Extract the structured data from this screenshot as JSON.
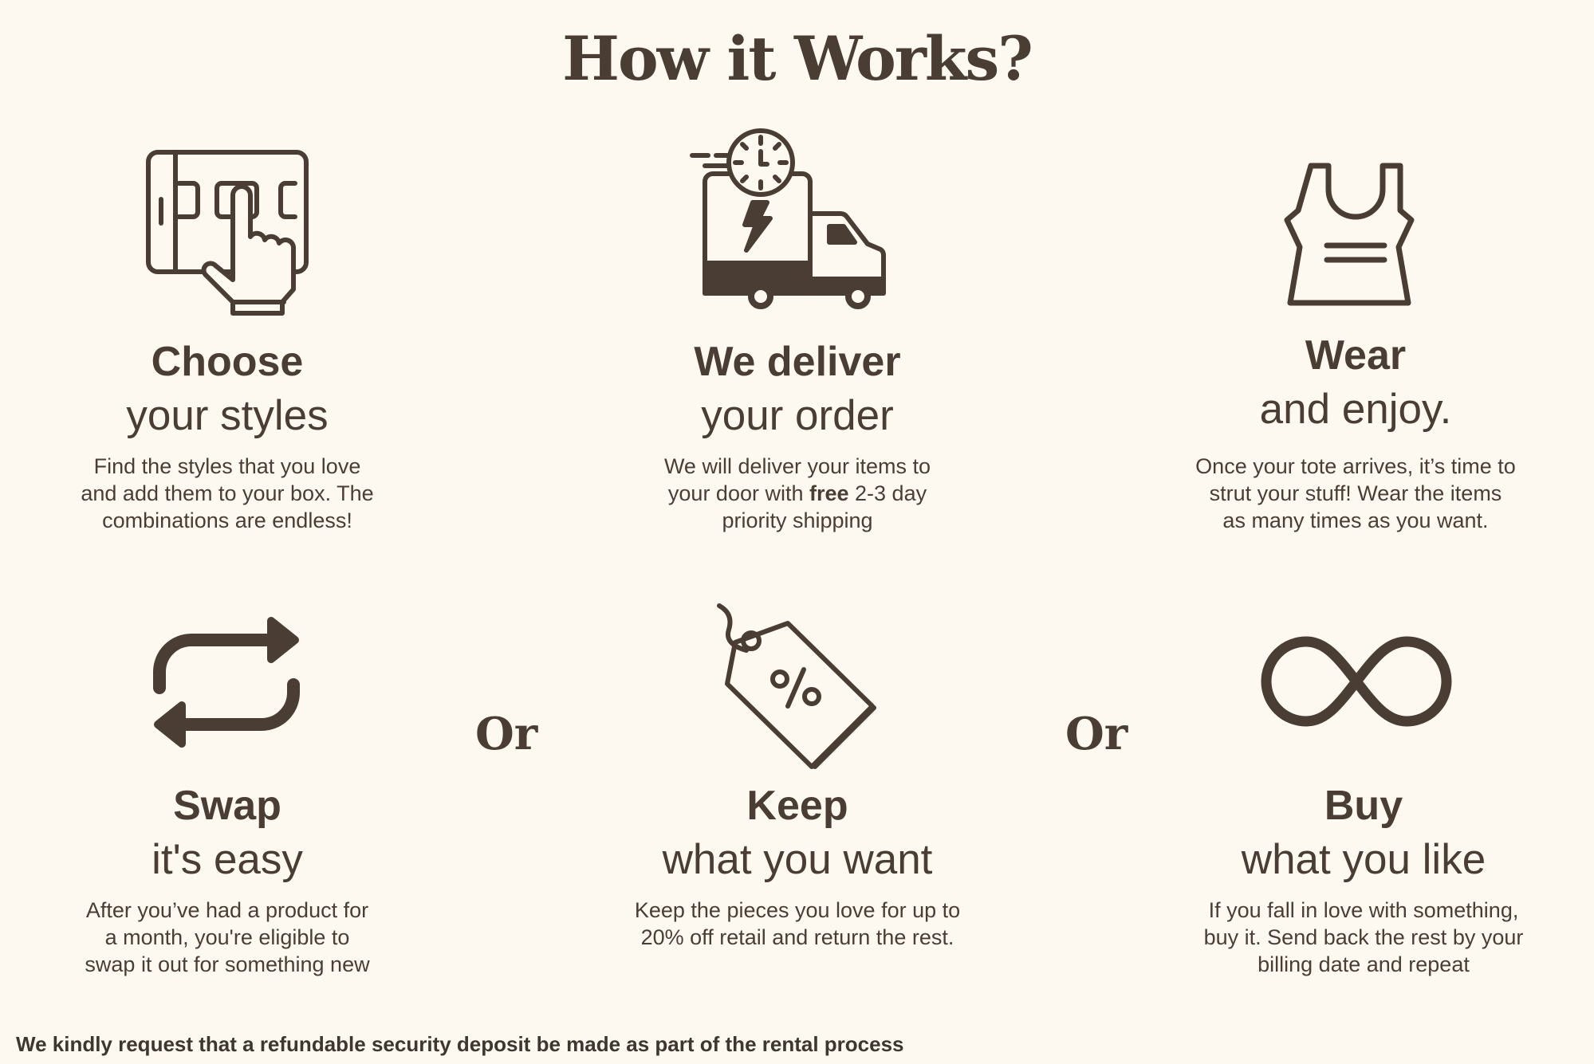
{
  "title": "How it Works?",
  "steps": [
    {
      "icon": "tablet-tap-icon",
      "title": "Choose",
      "subtitle": "your styles",
      "desc": [
        "Find the styles that you love",
        "and add them to your box. The",
        "combinations are endless!"
      ]
    },
    {
      "icon": "delivery-truck-clock-icon",
      "title": "We deliver",
      "subtitle": "your order",
      "desc_a": "We will deliver your items to",
      "desc_b_pre": "your door with ",
      "desc_b_bold": "free",
      "desc_b_post": " 2-3 day",
      "desc_c": "priority shipping"
    },
    {
      "icon": "tank-top-icon",
      "title": "Wear",
      "subtitle": "and enjoy.",
      "desc": [
        "Once your tote arrives, it’s time to",
        "strut your stuff! Wear the items",
        "as many times as you want."
      ]
    },
    {
      "icon": "swap-arrows-icon",
      "title": "Swap",
      "subtitle": "it's easy",
      "desc": [
        "After you’ve had a product for",
        "a month, you're eligible to",
        "swap it out for something new"
      ]
    },
    {
      "icon": "price-tag-percent-icon",
      "title": "Keep",
      "subtitle": "what you want",
      "desc": [
        "Keep the pieces you love for up to",
        "20% off retail and return the rest."
      ]
    },
    {
      "icon": "infinity-icon",
      "title": "Buy",
      "subtitle": "what you like",
      "desc": [
        "If you fall in love with something,",
        "buy it. Send back the rest by your",
        "billing date and repeat"
      ]
    }
  ],
  "separators": [
    "Or",
    "Or"
  ],
  "note": "We kindly request that a refundable security deposit be made as part of the rental process",
  "colors": {
    "background": "#fdf9f1",
    "text": "#4a3d34"
  }
}
